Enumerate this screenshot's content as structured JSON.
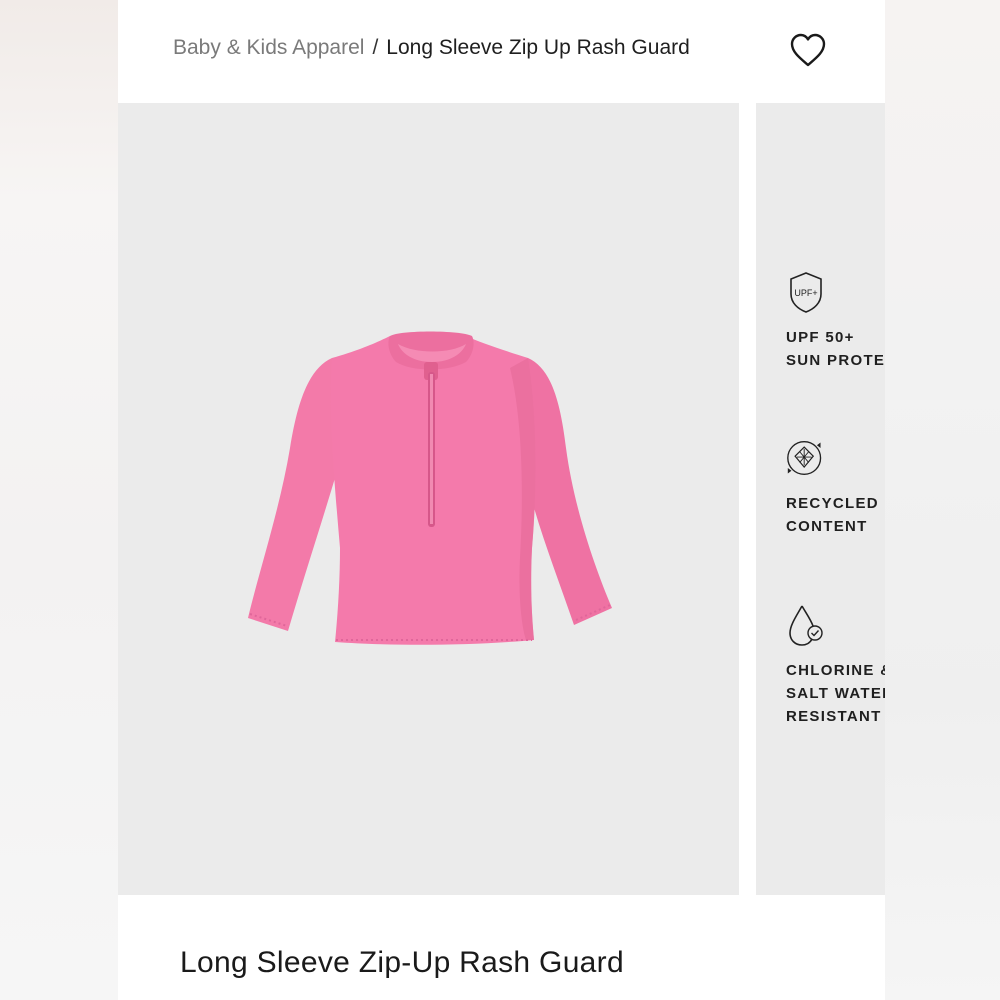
{
  "breadcrumb": {
    "parent": "Baby & Kids Apparel",
    "separator": "/",
    "current": "Long Sleeve Zip Up Rash Guard"
  },
  "wishlist": {
    "icon": "heart-icon"
  },
  "product": {
    "title": "Long Sleeve Zip-Up Rash Guard",
    "color": "#f478a8"
  },
  "features": [
    {
      "icon": "upf-shield-icon",
      "badge": "UPF+",
      "lines": [
        "UPF 50+",
        "SUN PROTEC"
      ]
    },
    {
      "icon": "recycle-icon",
      "lines": [
        "RECYCLED",
        "CONTENT"
      ]
    },
    {
      "icon": "water-drop-check-icon",
      "lines": [
        "CHLORINE &",
        "SALT WATER",
        "RESISTANT"
      ]
    }
  ],
  "colors": {
    "image_background": "#ebebeb",
    "text": "#1f1f1f",
    "muted_text": "#7a7a7a"
  }
}
